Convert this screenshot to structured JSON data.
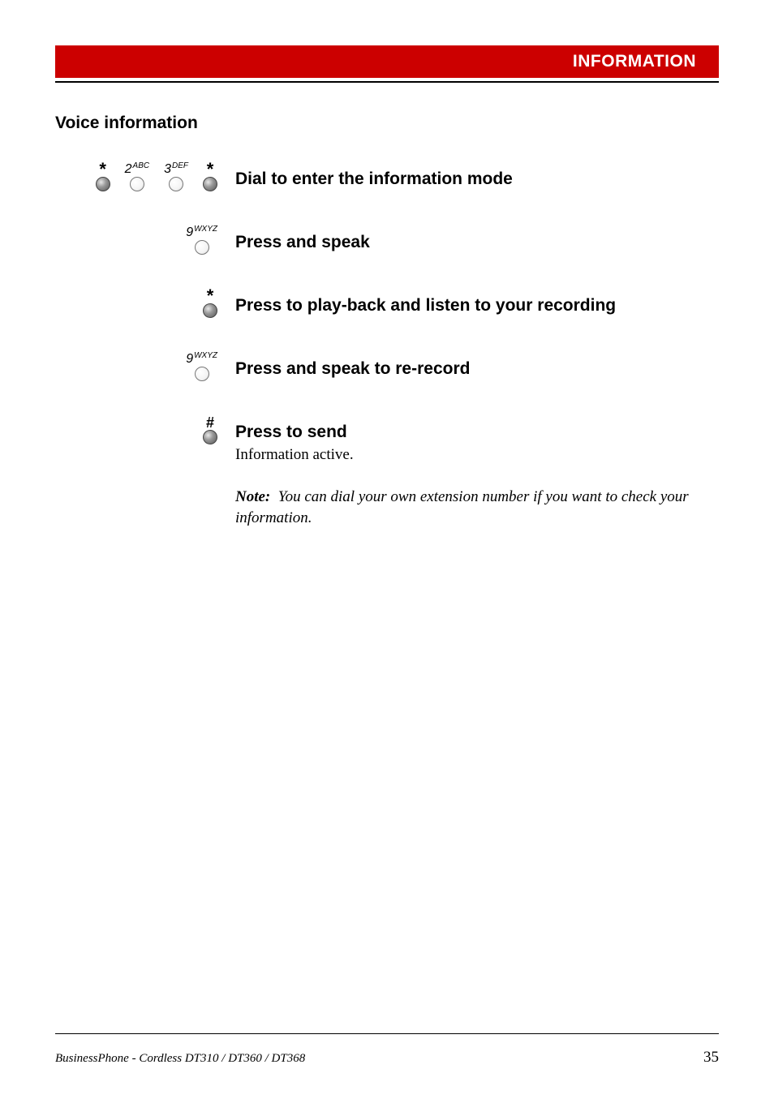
{
  "header": {
    "title": "INFORMATION"
  },
  "section": {
    "heading": "Voice information"
  },
  "keys": {
    "star": {
      "sym": "*"
    },
    "hash": {
      "sym": "#"
    },
    "two": {
      "digit": "2",
      "letters": "ABC"
    },
    "three": {
      "digit": "3",
      "letters": "DEF"
    },
    "nine": {
      "digit": "9",
      "letters": "WXYZ"
    }
  },
  "steps": {
    "dial": {
      "main": "Dial to enter the information mode"
    },
    "speak": {
      "main": "Press and speak"
    },
    "playback": {
      "main": "Press to play-back and listen to your recording"
    },
    "rerecord": {
      "main": "Press and speak to re-record"
    },
    "send": {
      "main": "Press to send",
      "sub": "Information active."
    }
  },
  "note": {
    "label": "Note:",
    "text": "You can dial your own extension number if you want to check your information."
  },
  "footer": {
    "left": "BusinessPhone - Cordless DT310 / DT360 / DT368",
    "page": "35"
  }
}
